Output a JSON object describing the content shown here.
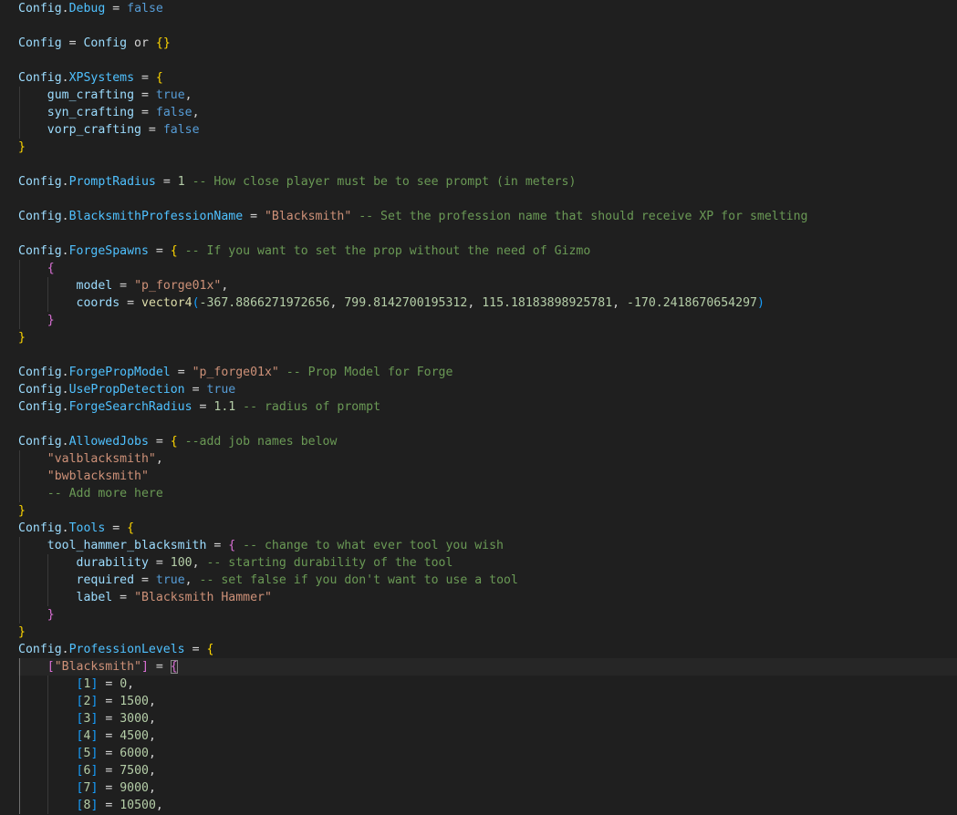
{
  "editor": {
    "language": "lua",
    "theme": "dark",
    "colors": {
      "background": "#1f1f1f",
      "variable": "#9cdcfe",
      "field": "#4fc1ff",
      "boolean": "#569cd6",
      "number": "#b5cea8",
      "string": "#ce9178",
      "comment": "#6a9955",
      "function": "#dcdcaa",
      "bracket_level_1": "#ffd700",
      "bracket_level_2": "#da70d6",
      "bracket_level_3": "#179fff"
    },
    "lines": [
      {
        "indent": 0,
        "tokens": [
          [
            "var",
            "Config"
          ],
          [
            "p",
            "."
          ],
          [
            "field",
            "Debug"
          ],
          [
            "op",
            " = "
          ],
          [
            "bool",
            "false"
          ]
        ]
      },
      {
        "indent": 0,
        "tokens": []
      },
      {
        "indent": 0,
        "tokens": [
          [
            "var",
            "Config"
          ],
          [
            "op",
            " = "
          ],
          [
            "var",
            "Config"
          ],
          [
            "kw",
            " or "
          ],
          [
            "b1",
            "{}"
          ]
        ]
      },
      {
        "indent": 0,
        "tokens": []
      },
      {
        "indent": 0,
        "tokens": [
          [
            "var",
            "Config"
          ],
          [
            "p",
            "."
          ],
          [
            "field",
            "XPSystems"
          ],
          [
            "op",
            " = "
          ],
          [
            "b1",
            "{"
          ]
        ]
      },
      {
        "indent": 1,
        "tokens": [
          [
            "prop",
            "gum_crafting"
          ],
          [
            "op",
            " = "
          ],
          [
            "bool",
            "true"
          ],
          [
            "p",
            ","
          ]
        ]
      },
      {
        "indent": 1,
        "tokens": [
          [
            "prop",
            "syn_crafting"
          ],
          [
            "op",
            " = "
          ],
          [
            "bool",
            "false"
          ],
          [
            "p",
            ","
          ]
        ]
      },
      {
        "indent": 1,
        "tokens": [
          [
            "prop",
            "vorp_crafting"
          ],
          [
            "op",
            " = "
          ],
          [
            "bool",
            "false"
          ]
        ]
      },
      {
        "indent": 0,
        "tokens": [
          [
            "b1",
            "}"
          ]
        ]
      },
      {
        "indent": 0,
        "tokens": []
      },
      {
        "indent": 0,
        "tokens": [
          [
            "var",
            "Config"
          ],
          [
            "p",
            "."
          ],
          [
            "field",
            "PromptRadius"
          ],
          [
            "op",
            " = "
          ],
          [
            "num",
            "1"
          ],
          [
            "com",
            " -- How close player must be to see prompt (in meters)"
          ]
        ]
      },
      {
        "indent": 0,
        "tokens": []
      },
      {
        "indent": 0,
        "tokens": [
          [
            "var",
            "Config"
          ],
          [
            "p",
            "."
          ],
          [
            "field",
            "BlacksmithProfessionName"
          ],
          [
            "op",
            " = "
          ],
          [
            "str",
            "\"Blacksmith\""
          ],
          [
            "com",
            " -- Set the profession name that should receive XP for smelting"
          ]
        ]
      },
      {
        "indent": 0,
        "tokens": []
      },
      {
        "indent": 0,
        "tokens": [
          [
            "var",
            "Config"
          ],
          [
            "p",
            "."
          ],
          [
            "field",
            "ForgeSpawns"
          ],
          [
            "op",
            " = "
          ],
          [
            "b1",
            "{"
          ],
          [
            "com",
            " -- If you want to set the prop without the need of Gizmo"
          ]
        ]
      },
      {
        "indent": 1,
        "tokens": [
          [
            "b2",
            "{"
          ]
        ]
      },
      {
        "indent": 2,
        "tokens": [
          [
            "prop",
            "model"
          ],
          [
            "op",
            " = "
          ],
          [
            "str",
            "\"p_forge01x\""
          ],
          [
            "p",
            ","
          ]
        ]
      },
      {
        "indent": 2,
        "tokens": [
          [
            "prop",
            "coords"
          ],
          [
            "op",
            " = "
          ],
          [
            "fn",
            "vector4"
          ],
          [
            "b3",
            "("
          ],
          [
            "num",
            "-367.8866271972656"
          ],
          [
            "p",
            ", "
          ],
          [
            "num",
            "799.8142700195312"
          ],
          [
            "p",
            ", "
          ],
          [
            "num",
            "115.18183898925781"
          ],
          [
            "p",
            ", "
          ],
          [
            "num",
            "-170.2418670654297"
          ],
          [
            "b3",
            ")"
          ]
        ]
      },
      {
        "indent": 1,
        "tokens": [
          [
            "b2",
            "}"
          ]
        ]
      },
      {
        "indent": 0,
        "tokens": [
          [
            "b1",
            "}"
          ]
        ]
      },
      {
        "indent": 0,
        "tokens": []
      },
      {
        "indent": 0,
        "tokens": [
          [
            "var",
            "Config"
          ],
          [
            "p",
            "."
          ],
          [
            "field",
            "ForgePropModel"
          ],
          [
            "op",
            " = "
          ],
          [
            "str",
            "\"p_forge01x\""
          ],
          [
            "com",
            " -- Prop Model for Forge"
          ]
        ]
      },
      {
        "indent": 0,
        "tokens": [
          [
            "var",
            "Config"
          ],
          [
            "p",
            "."
          ],
          [
            "field",
            "UsePropDetection"
          ],
          [
            "op",
            " = "
          ],
          [
            "bool",
            "true"
          ]
        ]
      },
      {
        "indent": 0,
        "tokens": [
          [
            "var",
            "Config"
          ],
          [
            "p",
            "."
          ],
          [
            "field",
            "ForgeSearchRadius"
          ],
          [
            "op",
            " = "
          ],
          [
            "num",
            "1.1"
          ],
          [
            "com",
            " -- radius of prompt"
          ]
        ]
      },
      {
        "indent": 0,
        "tokens": []
      },
      {
        "indent": 0,
        "tokens": [
          [
            "var",
            "Config"
          ],
          [
            "p",
            "."
          ],
          [
            "field",
            "AllowedJobs"
          ],
          [
            "op",
            " = "
          ],
          [
            "b1",
            "{"
          ],
          [
            "com",
            " --add job names below"
          ]
        ]
      },
      {
        "indent": 1,
        "tokens": [
          [
            "str",
            "\"valblacksmith\""
          ],
          [
            "p",
            ","
          ]
        ]
      },
      {
        "indent": 1,
        "tokens": [
          [
            "str",
            "\"bwblacksmith\""
          ]
        ]
      },
      {
        "indent": 1,
        "tokens": [
          [
            "com",
            "-- Add more here"
          ]
        ]
      },
      {
        "indent": 0,
        "tokens": [
          [
            "b1",
            "}"
          ]
        ]
      },
      {
        "indent": 0,
        "tokens": [
          [
            "var",
            "Config"
          ],
          [
            "p",
            "."
          ],
          [
            "field",
            "Tools"
          ],
          [
            "op",
            " = "
          ],
          [
            "b1",
            "{"
          ]
        ]
      },
      {
        "indent": 1,
        "tokens": [
          [
            "prop",
            "tool_hammer_blacksmith"
          ],
          [
            "op",
            " = "
          ],
          [
            "b2",
            "{"
          ],
          [
            "com",
            " -- change to what ever tool you wish"
          ]
        ]
      },
      {
        "indent": 2,
        "tokens": [
          [
            "prop",
            "durability"
          ],
          [
            "op",
            " = "
          ],
          [
            "num",
            "100"
          ],
          [
            "p",
            ","
          ],
          [
            "com",
            " -- starting durability of the tool"
          ]
        ]
      },
      {
        "indent": 2,
        "tokens": [
          [
            "prop",
            "required"
          ],
          [
            "op",
            " = "
          ],
          [
            "bool",
            "true"
          ],
          [
            "p",
            ","
          ],
          [
            "com",
            " -- set false if you don't want to use a tool"
          ]
        ]
      },
      {
        "indent": 2,
        "tokens": [
          [
            "prop",
            "label"
          ],
          [
            "op",
            " = "
          ],
          [
            "str",
            "\"Blacksmith Hammer\""
          ]
        ]
      },
      {
        "indent": 1,
        "tokens": [
          [
            "b2",
            "}"
          ]
        ]
      },
      {
        "indent": 0,
        "tokens": [
          [
            "b1",
            "}"
          ]
        ]
      },
      {
        "indent": 0,
        "tokens": [
          [
            "var",
            "Config"
          ],
          [
            "p",
            "."
          ],
          [
            "field",
            "ProfessionLevels"
          ],
          [
            "op",
            " = "
          ],
          [
            "b1",
            "{"
          ]
        ]
      },
      {
        "indent": 1,
        "highlight": true,
        "tokens": [
          [
            "b2",
            "["
          ],
          [
            "str",
            "\"Blacksmith\""
          ],
          [
            "b2",
            "]"
          ],
          [
            "op",
            " = "
          ],
          [
            "bm",
            "{"
          ]
        ]
      },
      {
        "indent": 2,
        "tokens": [
          [
            "b3",
            "["
          ],
          [
            "num",
            "1"
          ],
          [
            "b3",
            "]"
          ],
          [
            "op",
            " = "
          ],
          [
            "num",
            "0"
          ],
          [
            "p",
            ","
          ]
        ]
      },
      {
        "indent": 2,
        "tokens": [
          [
            "b3",
            "["
          ],
          [
            "num",
            "2"
          ],
          [
            "b3",
            "]"
          ],
          [
            "op",
            " = "
          ],
          [
            "num",
            "1500"
          ],
          [
            "p",
            ","
          ]
        ]
      },
      {
        "indent": 2,
        "tokens": [
          [
            "b3",
            "["
          ],
          [
            "num",
            "3"
          ],
          [
            "b3",
            "]"
          ],
          [
            "op",
            " = "
          ],
          [
            "num",
            "3000"
          ],
          [
            "p",
            ","
          ]
        ]
      },
      {
        "indent": 2,
        "tokens": [
          [
            "b3",
            "["
          ],
          [
            "num",
            "4"
          ],
          [
            "b3",
            "]"
          ],
          [
            "op",
            " = "
          ],
          [
            "num",
            "4500"
          ],
          [
            "p",
            ","
          ]
        ]
      },
      {
        "indent": 2,
        "tokens": [
          [
            "b3",
            "["
          ],
          [
            "num",
            "5"
          ],
          [
            "b3",
            "]"
          ],
          [
            "op",
            " = "
          ],
          [
            "num",
            "6000"
          ],
          [
            "p",
            ","
          ]
        ]
      },
      {
        "indent": 2,
        "tokens": [
          [
            "b3",
            "["
          ],
          [
            "num",
            "6"
          ],
          [
            "b3",
            "]"
          ],
          [
            "op",
            " = "
          ],
          [
            "num",
            "7500"
          ],
          [
            "p",
            ","
          ]
        ]
      },
      {
        "indent": 2,
        "tokens": [
          [
            "b3",
            "["
          ],
          [
            "num",
            "7"
          ],
          [
            "b3",
            "]"
          ],
          [
            "op",
            " = "
          ],
          [
            "num",
            "9000"
          ],
          [
            "p",
            ","
          ]
        ]
      },
      {
        "indent": 2,
        "tokens": [
          [
            "b3",
            "["
          ],
          [
            "num",
            "8"
          ],
          [
            "b3",
            "]"
          ],
          [
            "op",
            " = "
          ],
          [
            "num",
            "10500"
          ],
          [
            "p",
            ","
          ]
        ]
      }
    ]
  }
}
